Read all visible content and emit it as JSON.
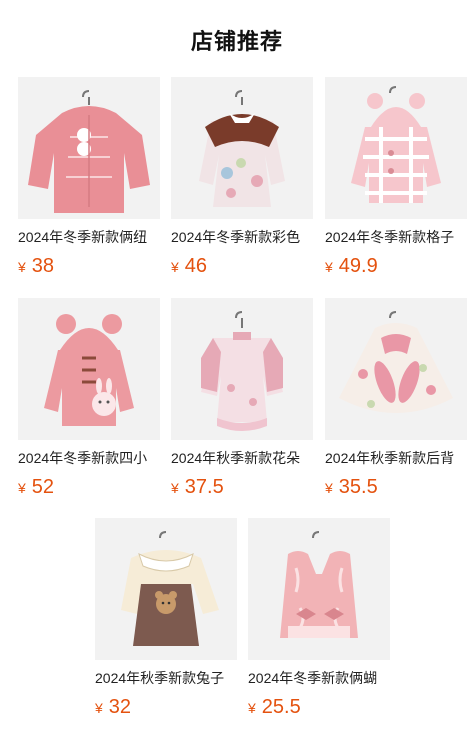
{
  "page": {
    "title": "店铺推荐"
  },
  "products": [
    {
      "name": "2024年冬季新款俩纽",
      "currency": "¥",
      "price": "38",
      "image": "pink-puffer-jacket",
      "colors": {
        "main": "#e98f96",
        "accent": "#f7d0d3"
      }
    },
    {
      "name": "2024年冬季新款彩色",
      "currency": "¥",
      "price": "46",
      "image": "floral-dress-brown-collar",
      "colors": {
        "main": "#f1e4e6",
        "accent": "#7a3b2a"
      }
    },
    {
      "name": "2024年冬季新款格子",
      "currency": "¥",
      "price": "49.9",
      "image": "pink-plaid-hooded-coat",
      "colors": {
        "main": "#f6c6cc",
        "accent": "#ffffff"
      }
    },
    {
      "name": "2024年冬季新款四小",
      "currency": "¥",
      "price": "52",
      "image": "pink-bear-hood-coat",
      "colors": {
        "main": "#ec9aa0",
        "accent": "#fbe7e9"
      }
    },
    {
      "name": "2024年秋季新款花朵",
      "currency": "¥",
      "price": "37.5",
      "image": "pink-qipao-dress",
      "colors": {
        "main": "#f4dfe4",
        "accent": "#e6a9b6"
      }
    },
    {
      "name": "2024年秋季新款后背",
      "currency": "¥",
      "price": "35.5",
      "image": "floral-bunny-cape",
      "colors": {
        "main": "#f6eee8",
        "accent": "#e997a6"
      }
    },
    {
      "name": "2024年秋季新款兔子",
      "currency": "¥",
      "price": "32",
      "image": "bear-pinafore-dress",
      "colors": {
        "main": "#7d5a4f",
        "accent": "#f6ecd7"
      }
    },
    {
      "name": "2024年冬季新款俩蝴",
      "currency": "¥",
      "price": "25.5",
      "image": "pink-fur-vest",
      "colors": {
        "main": "#f2b3b6",
        "accent": "#fbe2e3"
      }
    }
  ],
  "theme": {
    "price_color": "#e4520f",
    "thumb_bg": "#f2f2f2"
  }
}
